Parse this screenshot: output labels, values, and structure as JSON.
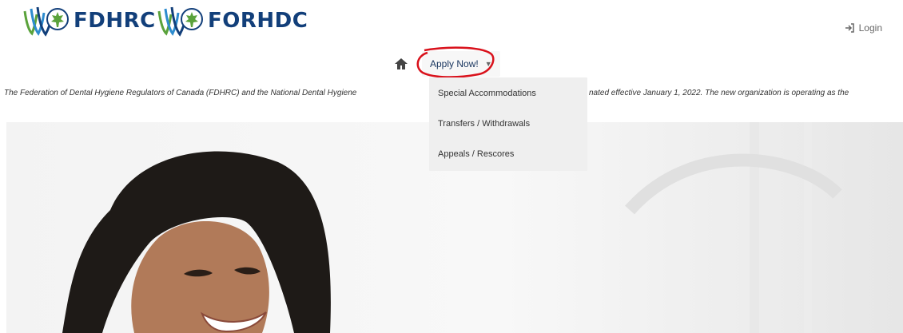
{
  "header": {
    "logos": [
      {
        "text": "FDHRC",
        "icon": "tooth-logo-icon"
      },
      {
        "text": "FORHDC",
        "icon": "tooth-logo-icon"
      }
    ],
    "login_label": "Login",
    "login_icon": "sign-in-icon"
  },
  "nav": {
    "home_icon": "home-icon",
    "apply_label": "Apply Now!",
    "apply_caret": "▼",
    "dropdown_items": [
      {
        "label": "Special Accommodations"
      },
      {
        "label": "Transfers / Withdrawals"
      },
      {
        "label": "Appeals / Rescores"
      }
    ]
  },
  "banner": {
    "text_left": "The Federation of Dental Hygiene Regulators of Canada (FDHRC) and the National Dental Hygiene",
    "text_right": "nated effective January 1, 2022. The new organization is operating as the"
  },
  "colors": {
    "brand_blue": "#123f7a",
    "leaf_green": "#5aa23b",
    "annotation_red": "#d9111b"
  }
}
